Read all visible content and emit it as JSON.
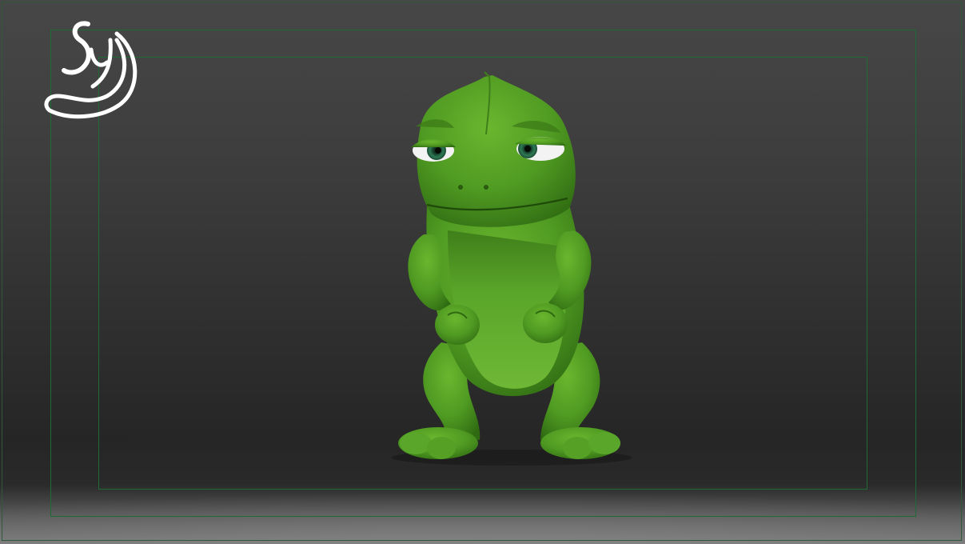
{
  "viewport": {
    "background_top": "#474747",
    "background_bottom": "#222222",
    "floor_color": "#262626",
    "floor_highlight": "#6e6e6e",
    "frame_color": "#1f6b35"
  },
  "logo": {
    "icon": "sy-swirl-logo-icon",
    "color": "#ffffff",
    "lettering": "Sy"
  },
  "character": {
    "description_icon": "green-chameleon-character",
    "skin_color": "#4f9a22",
    "skin_shadow": "#2f6a12",
    "eye_iris_color": "#2e7a55"
  }
}
